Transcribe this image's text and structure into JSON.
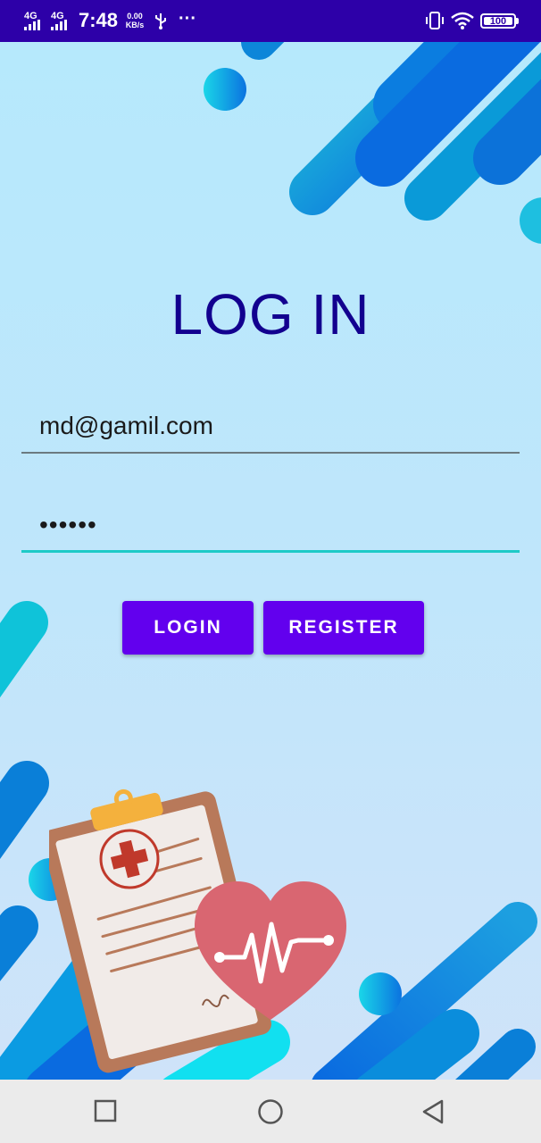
{
  "status_bar": {
    "network_1": "4G",
    "network_2": "4G",
    "time": "7:48",
    "speed_value": "0.00",
    "speed_unit": "KB/s",
    "more": "···",
    "battery": "100",
    "icons": [
      "signal-icon",
      "usb-icon",
      "vibrate-icon",
      "wifi-icon",
      "battery-icon"
    ]
  },
  "login": {
    "title": "LOG IN",
    "email_value": "md@gamil.com",
    "password_value": "••••••",
    "login_button": "LOGIN",
    "register_button": "REGISTER"
  },
  "illustration": {
    "icons": [
      "clipboard-icon",
      "medical-cross-icon",
      "heart-pulse-icon"
    ]
  },
  "nav_bar": {
    "icons": [
      "recent-apps-icon",
      "home-icon",
      "back-icon"
    ]
  },
  "colors": {
    "status_bar": "#2d00a8",
    "title": "#12008f",
    "primary_button": "#6200ee",
    "focused_underline": "#1ecac7",
    "nav_bar": "#ebebeb"
  }
}
